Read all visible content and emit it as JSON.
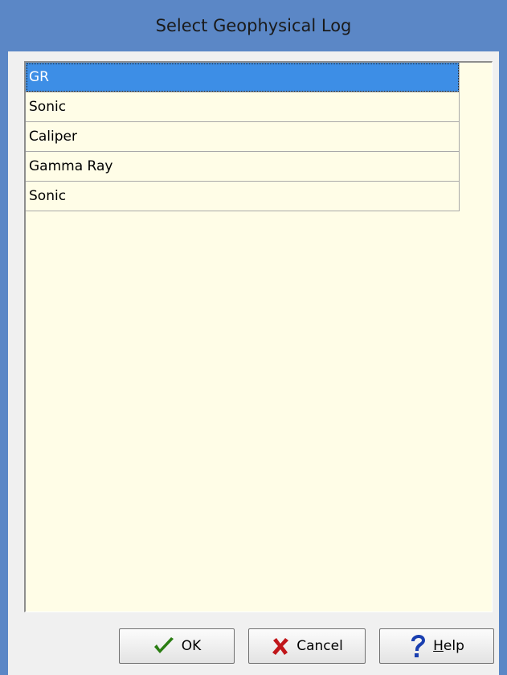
{
  "dialog": {
    "title": "Select Geophysical Log"
  },
  "list": {
    "items": [
      {
        "label": "GR",
        "selected": true
      },
      {
        "label": "Sonic",
        "selected": false
      },
      {
        "label": "Caliper",
        "selected": false
      },
      {
        "label": "Gamma Ray",
        "selected": false
      },
      {
        "label": "Sonic",
        "selected": false
      }
    ]
  },
  "buttons": {
    "ok_label": "OK",
    "cancel_label": "Cancel",
    "help_mnemonic": "H",
    "help_rest": "elp",
    "ok_icon": "checkmark-icon",
    "cancel_icon": "x-icon",
    "help_icon": "question-mark-icon"
  },
  "colors": {
    "titlebar": "#5b87c6",
    "list_background": "#fffde7",
    "selection": "#3d8ee6",
    "ok_icon": "#2a7d12",
    "cancel_icon": "#c0161a",
    "help_icon": "#1a3fb0"
  }
}
